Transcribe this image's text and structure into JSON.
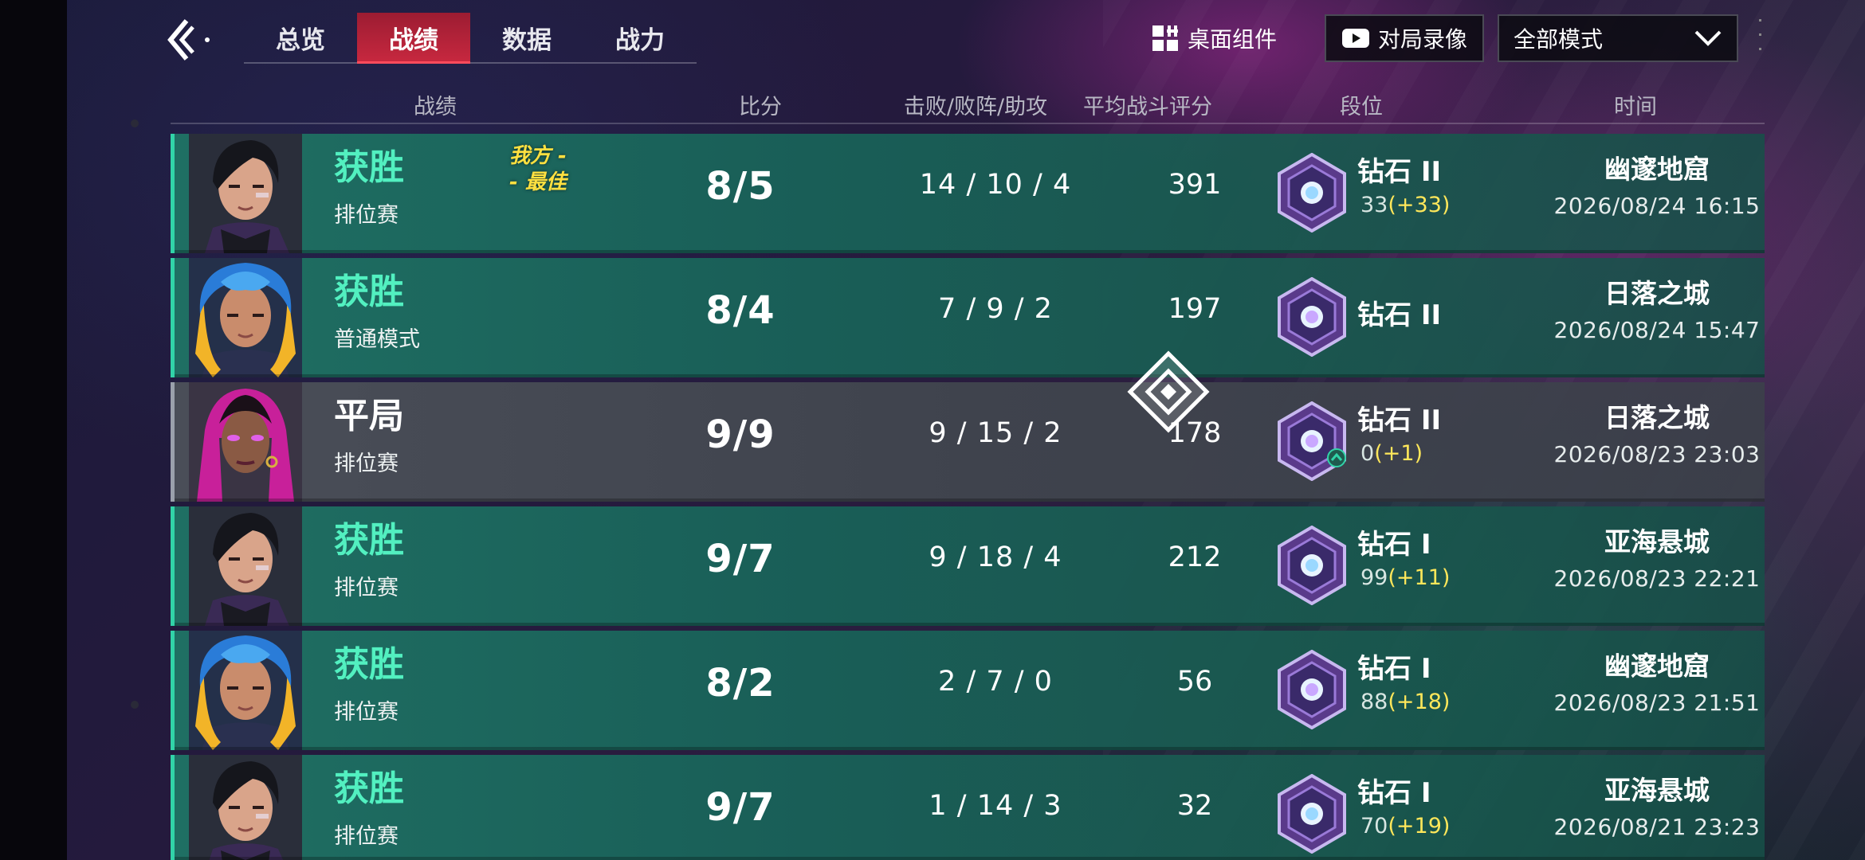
{
  "nav": {
    "back_icon": "back-arrow-icon",
    "tabs": [
      {
        "label": "总览",
        "active": false
      },
      {
        "label": "战绩",
        "active": true
      },
      {
        "label": "数据",
        "active": false
      },
      {
        "label": "战力",
        "active": false
      }
    ],
    "widget_label": "桌面组件",
    "replay_label": "对局录像",
    "mode_select_value": "全部模式"
  },
  "columns": {
    "record": "战绩",
    "score": "比分",
    "kda": "击败/败阵/助攻",
    "avg_rating": "平均战斗评分",
    "rank": "段位",
    "time": "时间"
  },
  "colors": {
    "win_text": "#52f0c0",
    "win_accent": "#31d3a8",
    "active_tab": "#c7283f",
    "points_delta": "#ffe75a",
    "mvp_text": "#ffe040"
  },
  "matches": [
    {
      "result": "获胜",
      "outcome": "win",
      "mode": "排位赛",
      "mvp_line1": "我方 -",
      "mvp_line2": "- 最佳",
      "score": "8/5",
      "kda": "14 / 10 / 4",
      "rating": "391",
      "rank": "钻石 II",
      "points": "33",
      "delta": "(+33)",
      "map": "幽邃地窟",
      "time": "2026/08/24 16:15",
      "agent": "agent-dark-hair"
    },
    {
      "result": "获胜",
      "outcome": "win",
      "mode": "普通模式",
      "score": "8/4",
      "kda": "7 / 9 / 2",
      "rating": "197",
      "rank": "钻石 II",
      "map": "日落之城",
      "time": "2026/08/24 15:47",
      "agent": "agent-blue-hair"
    },
    {
      "result": "平局",
      "outcome": "draw",
      "mode": "排位赛",
      "score": "9/9",
      "kda": "9 / 15 / 2",
      "rating": "178",
      "rank": "钻石 II",
      "points": "0",
      "delta": "(+1)",
      "map": "日落之城",
      "time": "2026/08/23 23:03",
      "agent": "agent-purple-hair"
    },
    {
      "result": "获胜",
      "outcome": "win",
      "mode": "排位赛",
      "score": "9/7",
      "kda": "9 / 18 / 4",
      "rating": "212",
      "rank": "钻石 I",
      "points": "99",
      "delta": "(+11)",
      "map": "亚海悬城",
      "time": "2026/08/23 22:21",
      "agent": "agent-dark-hair"
    },
    {
      "result": "获胜",
      "outcome": "win",
      "mode": "排位赛",
      "score": "8/2",
      "kda": "2 / 7 / 0",
      "rating": "56",
      "rank": "钻石 I",
      "points": "88",
      "delta": "(+18)",
      "map": "幽邃地窟",
      "time": "2026/08/23 21:51",
      "agent": "agent-blue-hair"
    },
    {
      "result": "获胜",
      "outcome": "win",
      "mode": "排位赛",
      "score": "9/7",
      "kda": "1 / 14 / 3",
      "rating": "32",
      "rank": "钻石 I",
      "points": "70",
      "delta": "(+19)",
      "map": "亚海悬城",
      "time": "2026/08/21 23:23",
      "agent": "agent-dark-hair"
    }
  ]
}
